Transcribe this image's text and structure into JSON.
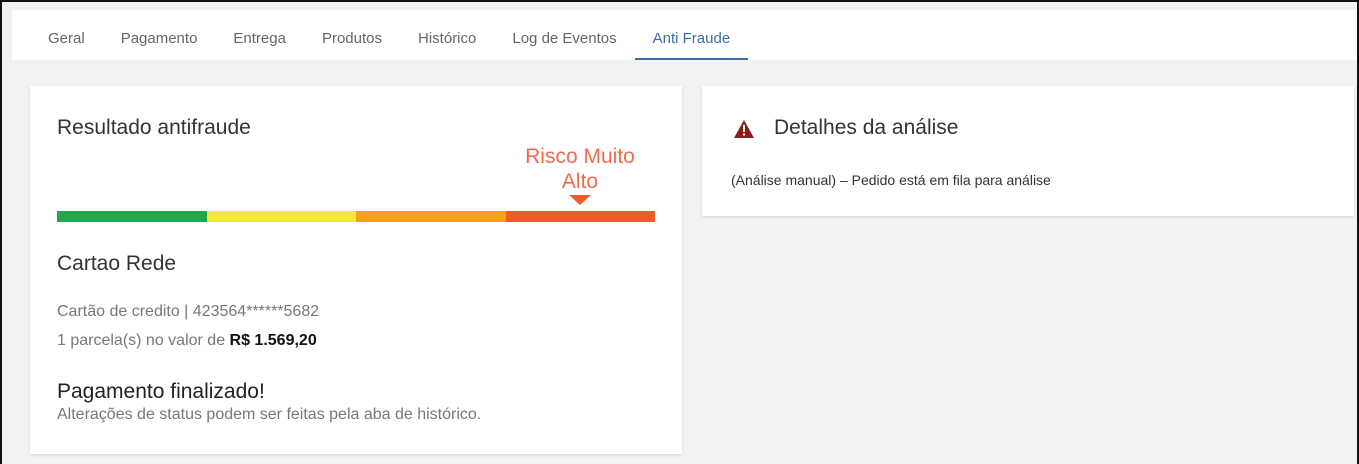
{
  "tabs": [
    {
      "label": "Geral",
      "active": false
    },
    {
      "label": "Pagamento",
      "active": false
    },
    {
      "label": "Entrega",
      "active": false
    },
    {
      "label": "Produtos",
      "active": false
    },
    {
      "label": "Histórico",
      "active": false
    },
    {
      "label": "Log de Eventos",
      "active": false
    },
    {
      "label": "Anti Fraude",
      "active": true
    }
  ],
  "antifraud": {
    "title": "Resultado antifraude",
    "risk_label": "Risco Muito Alto",
    "risk_level_index": 3,
    "risk_colors": [
      "#22a84a",
      "#f5e83a",
      "#f7a020",
      "#f15a2b"
    ],
    "risk_text_color": "#ee6c4d"
  },
  "payment": {
    "card_name": "Cartao Rede",
    "card_info": "Cartão de credito | 423564******5682",
    "installments_prefix": "1 parcela(s) no valor de ",
    "installments_value": "R$ 1.569,20",
    "status_title": "Pagamento finalizado!",
    "status_subtitle": "Alterações de status podem ser feitas pela aba de histórico."
  },
  "details": {
    "icon": "warning-icon",
    "title": "Detalhes da análise",
    "text": "(Análise manual) – Pedido está em fila para análise"
  },
  "colors": {
    "accent": "#3a6ea8",
    "warning_icon": "#8b1c1c"
  }
}
